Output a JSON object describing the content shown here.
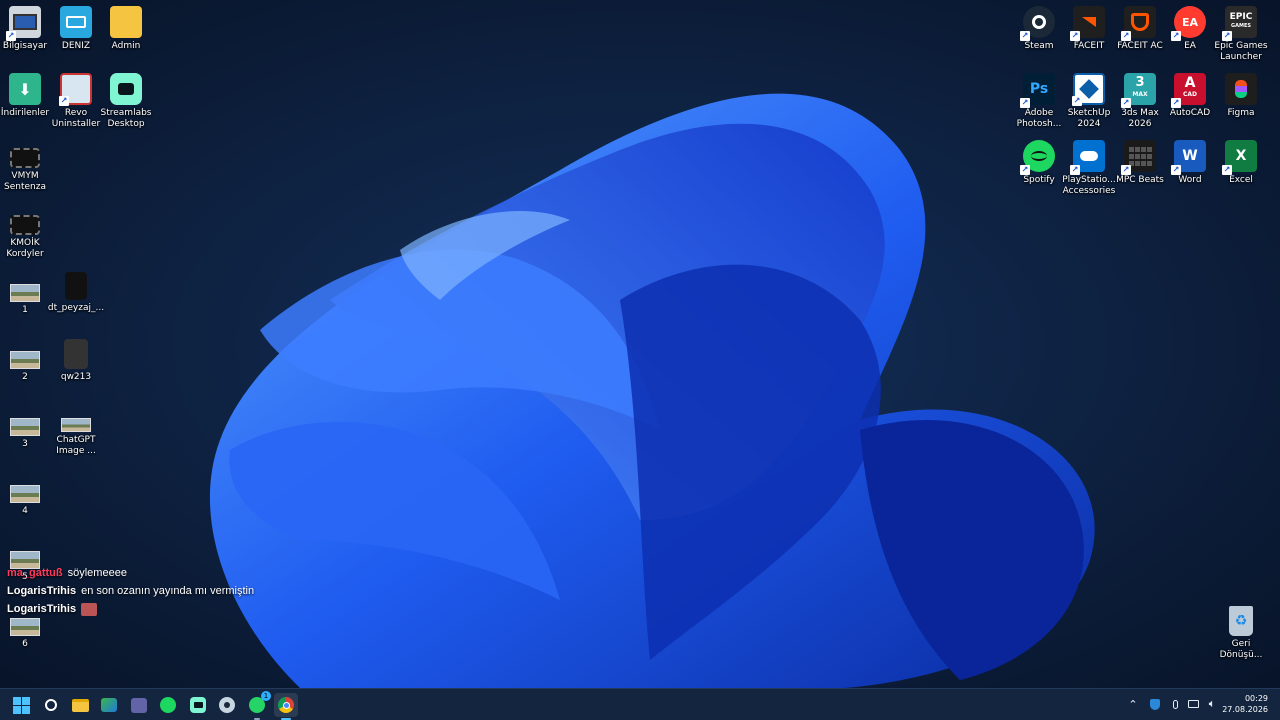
{
  "desktop_left": [
    {
      "name": "bilgisayar-icon",
      "label": "Bilgisayar"
    },
    {
      "name": "deniz-icon",
      "label": "DENIZ"
    },
    {
      "name": "admin-folder-icon",
      "label": "Admin"
    },
    {
      "name": "indirilenler-folder-icon",
      "label": "İndirilenler"
    },
    {
      "name": "revo-uninstaller-icon",
      "label": "Revo Uninstaller"
    },
    {
      "name": "streamlabs-desktop-icon",
      "label": "Streamlabs Desktop"
    },
    {
      "name": "video-file-icon",
      "label": "VMYM Sentenza"
    },
    {
      "name": "video-file-icon",
      "label": "KMOİK Kordyler"
    },
    {
      "name": "image-file-icon",
      "label": "1"
    },
    {
      "name": "file-icon",
      "label": "dt_peyzaj_..."
    },
    {
      "name": "image-file-icon",
      "label": "2"
    },
    {
      "name": "file-icon",
      "label": "qw213"
    },
    {
      "name": "image-file-icon",
      "label": "3"
    },
    {
      "name": "image-file-icon",
      "label": "ChatGPT Image ..."
    },
    {
      "name": "image-file-icon",
      "label": "4"
    },
    {
      "name": "image-file-icon",
      "label": "5"
    },
    {
      "name": "image-file-icon",
      "label": "6"
    }
  ],
  "desktop_right": [
    {
      "name": "steam-icon",
      "label": "Steam"
    },
    {
      "name": "faceit-icon",
      "label": "FACEIT"
    },
    {
      "name": "faceit-ac-icon",
      "label": "FACEIT AC"
    },
    {
      "name": "ea-icon",
      "label": "EA"
    },
    {
      "name": "epic-games-icon",
      "label": "Epic Games Launcher"
    },
    {
      "name": "photoshop-icon",
      "label": "Adobe Photosh..."
    },
    {
      "name": "sketchup-icon",
      "label": "SketchUp 2024"
    },
    {
      "name": "3dsmax-icon",
      "label": "3ds Max 2026"
    },
    {
      "name": "autocad-icon",
      "label": "AutoCAD"
    },
    {
      "name": "figma-icon",
      "label": "Figma"
    },
    {
      "name": "spotify-icon",
      "label": "Spotify"
    },
    {
      "name": "playstation-accessories-icon",
      "label": "PlayStatio... Accessories"
    },
    {
      "name": "mpc-beats-icon",
      "label": "MPC Beats"
    },
    {
      "name": "word-icon",
      "label": "Word"
    },
    {
      "name": "excel-icon",
      "label": "Excel"
    },
    {
      "name": "recycle-bin-icon",
      "label": "Geri Dönüşü..."
    }
  ],
  "icon_text": {
    "ps": "Ps",
    "max": "3",
    "max_small": "MAX",
    "acad": "A",
    "acad_small": "CAD",
    "epic": "EPIC",
    "epic_small": "GAMES",
    "ea": "EA",
    "word": "W",
    "excel": "X"
  },
  "chat": [
    {
      "user": "ma_gattuß",
      "user_color": "#ff3b5c",
      "message": "söylemeeee"
    },
    {
      "user": "LogarisTrihis",
      "user_color": "#ffffff",
      "message": "en son ozanın yayında mı vermiştin"
    },
    {
      "user": "LogarisTrihis",
      "user_color": "#ffffff",
      "message": ""
    }
  ],
  "taskbar": {
    "time": "00:29",
    "date": "27.08.2026",
    "whatsapp_badge": "1",
    "apps": [
      "start-icon",
      "search-icon",
      "file-explorer-icon",
      "map-app-icon",
      "teams-icon",
      "spotify-icon",
      "streamlabs-icon",
      "steam-icon",
      "whatsapp-icon",
      "chrome-icon"
    ]
  }
}
